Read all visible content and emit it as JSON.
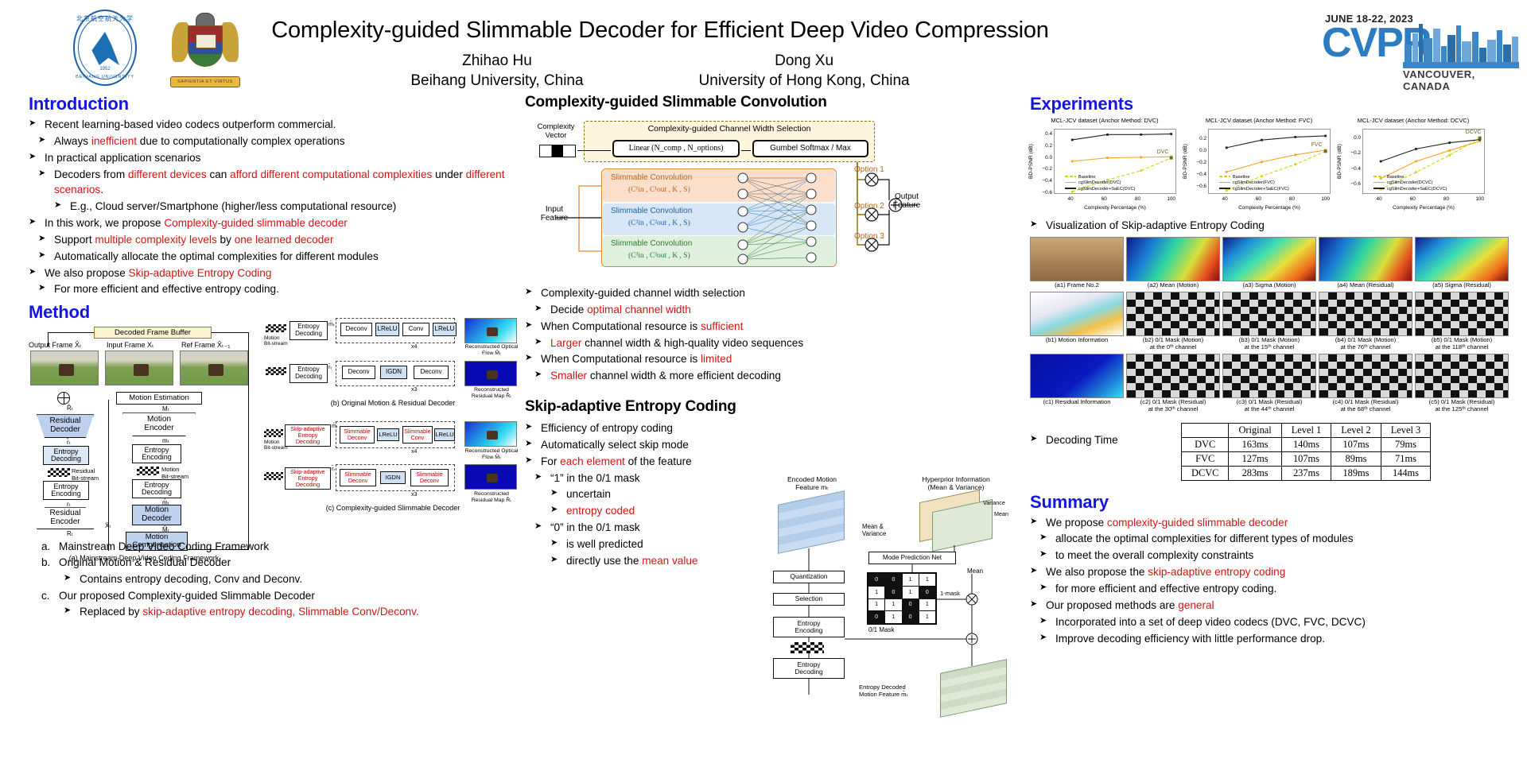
{
  "header": {
    "title": "Complexity-guided Slimmable Decoder for Efficient Deep Video Compression",
    "authors": [
      {
        "name": "Zhihao Hu",
        "affiliation": "Beihang University, China"
      },
      {
        "name": "Dong Xu",
        "affiliation": "University of Hong Kong, China"
      }
    ],
    "logo_buaa": {
      "cn": "北京航空航天大学",
      "year": "1952",
      "en": "BEIHANG UNIVERSITY"
    },
    "logo_hku": {
      "motto": "SAPIENTIA ET VIRTUS"
    },
    "cvpr": {
      "date": "JUNE 18-22, 2023",
      "word": "CVPR",
      "city": "VANCOUVER, CANADA"
    }
  },
  "introduction": {
    "heading": "Introduction",
    "items": [
      {
        "level": 0,
        "parts": [
          {
            "t": "Recent learning-based video codecs outperform commercial.",
            "c": "k"
          }
        ]
      },
      {
        "level": 1,
        "parts": [
          {
            "t": "Always ",
            "c": "k"
          },
          {
            "t": "inefficient",
            "c": "r"
          },
          {
            "t": " due to computationally complex operations",
            "c": "k"
          }
        ]
      },
      {
        "level": 0,
        "parts": [
          {
            "t": "In practical application scenarios",
            "c": "k"
          }
        ]
      },
      {
        "level": 1,
        "parts": [
          {
            "t": "Decoders from ",
            "c": "k"
          },
          {
            "t": "different devices",
            "c": "r"
          },
          {
            "t": " can ",
            "c": "k"
          },
          {
            "t": "afford different computational complexities",
            "c": "r"
          },
          {
            "t": " under ",
            "c": "k"
          },
          {
            "t": "different scenarios",
            "c": "r"
          },
          {
            "t": ".",
            "c": "k"
          }
        ]
      },
      {
        "level": 2,
        "parts": [
          {
            "t": "E.g., Cloud server/Smartphone (higher/less computational resource)",
            "c": "k"
          }
        ]
      },
      {
        "level": 0,
        "parts": [
          {
            "t": "In this work, we propose ",
            "c": "k"
          },
          {
            "t": "Complexity-guided slimmable decoder",
            "c": "r"
          }
        ]
      },
      {
        "level": 1,
        "parts": [
          {
            "t": "Support ",
            "c": "k"
          },
          {
            "t": "multiple complexity levels",
            "c": "r"
          },
          {
            "t": " by ",
            "c": "k"
          },
          {
            "t": "one learned decoder",
            "c": "r"
          }
        ]
      },
      {
        "level": 1,
        "parts": [
          {
            "t": "Automatically allocate the optimal complexities for different modules",
            "c": "k"
          }
        ]
      },
      {
        "level": 0,
        "parts": [
          {
            "t": "We also propose ",
            "c": "k"
          },
          {
            "t": "Skip-adaptive Entropy Coding",
            "c": "r"
          }
        ]
      },
      {
        "level": 1,
        "parts": [
          {
            "t": "For more efficient and effective entropy coding.",
            "c": "k"
          }
        ]
      }
    ]
  },
  "method": {
    "heading": "Method",
    "diagram_a": {
      "caption": "(a) Mainstream Deep Video Coding Framework",
      "decoded_frame_buffer": "Decoded Frame Buffer",
      "frames": [
        "Output Frame X̂ₜ",
        "Input Frame Xₜ",
        "Ref Frame X̂ₜ₋₁"
      ],
      "blocks": [
        "Residual\nDecoder",
        "Entropy\nDecoding",
        "Entropy\nEncoding",
        "Residual\nEncoder",
        "Motion Estimation",
        "Motion\nEncoder",
        "Entropy\nEncoding",
        "Entropy\nDecoding",
        "Motion\nDecoder",
        "Motion\nCompensation"
      ],
      "streams": [
        "Residual\nBit-stream",
        "Motion\nBit-stream"
      ],
      "signals": [
        "R̂ₜ",
        "r̂ₜ",
        "rₜ",
        "Rₜ",
        "Mₜ",
        "mₜ",
        "m̂ₜ",
        "M̂ₜ",
        "X̄ₜ"
      ]
    },
    "diagram_b": {
      "caption": "(b) Original Motion & Residual Decoder",
      "blocks": [
        "Entropy\nDecoding",
        "Deconv",
        "LReLU",
        "Conv",
        "LReLU",
        "Entropy\nDecoding",
        "Deconv",
        "IGDN",
        "Deconv"
      ],
      "repeats": [
        "x4",
        "x3"
      ],
      "outputs": [
        "Reconstructed\nOptical Flow M̂ₜ",
        "Reconstructed\nResidual Map R̂ₜ"
      ],
      "labels": [
        "m̂ₜ",
        "r̂ₜ",
        "Motion\nBit-stream"
      ]
    },
    "diagram_c": {
      "caption": "(c) Complexity-guided Slimmable Decoder",
      "blocks": [
        "Skip-adaptive\nEntropy\nDecoding",
        "Slimmable\nDeconv",
        "LReLU",
        "Slimmable\nConv",
        "LReLU",
        "Skip-adaptive\nEntropy\nDecoding",
        "Slimmable\nDeconv",
        "IGDN",
        "Slimmable\nDeconv"
      ],
      "repeats": [
        "x4",
        "x3"
      ],
      "outputs": [
        "Reconstructed\nOptical Flow M̂ₜ",
        "Reconstructed\nResidual Map R̂ₜ"
      ],
      "labels": [
        "m̂ₜ",
        "r̂ₜ",
        "Motion\nBit-stream"
      ]
    },
    "legend_items": [
      {
        "key": "a.",
        "text": "Mainstream Deep Video Coding Framework",
        "sub": []
      },
      {
        "key": "b.",
        "text": "Original Motion & Residual Decoder",
        "sub": [
          {
            "parts": [
              {
                "t": "Contains entropy decoding, Conv and Deconv.",
                "c": "k"
              }
            ]
          }
        ]
      },
      {
        "key": "c.",
        "text": "Our proposed Complexity-guided Slimmable Decoder",
        "sub": [
          {
            "parts": [
              {
                "t": "Replaced by ",
                "c": "k"
              },
              {
                "t": "skip-adaptive entropy decoding, Slimmable Conv/Deconv.",
                "c": "r"
              }
            ]
          }
        ]
      }
    ]
  },
  "slimconv": {
    "heading": "Complexity-guided Slimmable Convolution",
    "diagram": {
      "complexity_vector": "Complexity\nVector",
      "selector_title": "Complexity-guided Channel Width Selection",
      "linear": "Linear (N_comp , N_options)",
      "gumbel": "Gumbel Softmax / Max",
      "convs": [
        {
          "name": "Slimmable Convolution",
          "params": "(C¹in , C¹out , K , S)"
        },
        {
          "name": "Slimmable Convolution",
          "params": "(C²in , C²out , K , S)"
        },
        {
          "name": "Slimmable Convolution",
          "params": "(C³in , C³out , K , S)"
        }
      ],
      "options": [
        "Option 1",
        "Option 2",
        "Option 3"
      ],
      "input_label": "Input\nFeature",
      "output_label": "Output\nFeature"
    },
    "bullets": [
      {
        "level": 0,
        "parts": [
          {
            "t": "Complexity-guided channel width selection",
            "c": "k"
          }
        ]
      },
      {
        "level": 1,
        "parts": [
          {
            "t": "Decide ",
            "c": "k"
          },
          {
            "t": "optimal channel width",
            "c": "r"
          }
        ]
      },
      {
        "level": 0,
        "parts": [
          {
            "t": "When Computational resource is ",
            "c": "k"
          },
          {
            "t": "sufficient",
            "c": "r"
          }
        ]
      },
      {
        "level": 1,
        "parts": [
          {
            "t": "Larger",
            "c": "r"
          },
          {
            "t": " channel width & high-quality video sequences",
            "c": "k"
          }
        ]
      },
      {
        "level": 0,
        "parts": [
          {
            "t": "When Computational resource is ",
            "c": "k"
          },
          {
            "t": "limited",
            "c": "r"
          }
        ]
      },
      {
        "level": 1,
        "parts": [
          {
            "t": "Smaller",
            "c": "r"
          },
          {
            "t": " channel width & more efficient decoding",
            "c": "k"
          }
        ]
      }
    ]
  },
  "skipadaptive": {
    "heading": "Skip-adaptive Entropy Coding",
    "bullets": [
      {
        "level": 0,
        "parts": [
          {
            "t": "Efficiency of entropy coding",
            "c": "k"
          }
        ]
      },
      {
        "level": 0,
        "parts": [
          {
            "t": "Automatically select skip mode",
            "c": "k"
          }
        ]
      },
      {
        "level": 0,
        "parts": [
          {
            "t": "For ",
            "c": "k"
          },
          {
            "t": "each element",
            "c": "r"
          },
          {
            "t": " of the feature",
            "c": "k"
          }
        ]
      },
      {
        "level": 1,
        "parts": [
          {
            "t": "“1” in the 0/1 mask",
            "c": "k"
          }
        ]
      },
      {
        "level": 2,
        "parts": [
          {
            "t": "uncertain",
            "c": "k"
          }
        ]
      },
      {
        "level": 2,
        "parts": [
          {
            "t": "entropy coded",
            "c": "r"
          }
        ]
      },
      {
        "level": 1,
        "parts": [
          {
            "t": "“0” in the 0/1 mask",
            "c": "k"
          }
        ]
      },
      {
        "level": 2,
        "parts": [
          {
            "t": "is well predicted",
            "c": "k"
          }
        ]
      },
      {
        "level": 2,
        "parts": [
          {
            "t": "directly use the ",
            "c": "k"
          },
          {
            "t": "mean value",
            "c": "r"
          }
        ]
      }
    ],
    "diagram": {
      "encoded_title": "Encoded Motion\nFeature mₜ",
      "hyper_title": "Hyperprior Information\n(Mean & Variance)",
      "variance": "Variance",
      "mean": "Mean",
      "mean_variance": "Mean &\nVariance",
      "mode_net": "Mode Prediction Net",
      "quantization": "Quantization",
      "selection": "Selection",
      "entropy_encoding": "Entropy\nEncoding",
      "entropy_decoding": "Entropy\nDecoding",
      "mask_label": "0/1 Mask",
      "one_minus_mask": "1-mask",
      "mean_label": "Mean",
      "decoded_label": "Entropy Decoded\nMotion Feature m̂ₜ",
      "mask_bits": [
        [
          "0",
          "0",
          "1",
          "1"
        ],
        [
          "1",
          "0",
          "1",
          "0"
        ],
        [
          "1",
          "1",
          "0",
          "1"
        ],
        [
          "0",
          "1",
          "0",
          "1"
        ]
      ]
    }
  },
  "experiments": {
    "heading": "Experiments",
    "viz_heading": "Visualization of Skip-adaptive Entropy Coding",
    "decoding_time_heading": "Decoding Time",
    "viz_cells": [
      {
        "cap": "(a1) Frame No.2",
        "kind": "photo"
      },
      {
        "cap": "(a2) Mean (Motion)",
        "kind": "jet"
      },
      {
        "cap": "(a3) Sigma (Motion)",
        "kind": "jet2"
      },
      {
        "cap": "(a4) Mean (Residual)",
        "kind": "jet"
      },
      {
        "cap": "(a5) Sigma (Residual)",
        "kind": "jet2"
      },
      {
        "cap": "(b1) Motion Information",
        "kind": "motion"
      },
      {
        "cap": "(b2) 0/1 Mask (Motion)\nat the 0ᵗʰ channel",
        "kind": "mask"
      },
      {
        "cap": "(b3) 0/1 Mask (Motion)\nat the 15ᵗʰ channel",
        "kind": "mask"
      },
      {
        "cap": "(b4) 0/1 Mask (Motion)\nat the 76ᵗʰ channel",
        "kind": "mask"
      },
      {
        "cap": "(b5) 0/1 Mask (Motion)\nat the 118ᵗʰ channel",
        "kind": "mask"
      },
      {
        "cap": "(c1) Residual Information",
        "kind": "residual"
      },
      {
        "cap": "(c2) 0/1 Mask (Residual)\nat the 30ᵗʰ channel",
        "kind": "mask"
      },
      {
        "cap": "(c3) 0/1 Mask (Residual)\nat the 44ᵗʰ channel",
        "kind": "mask"
      },
      {
        "cap": "(c4) 0/1 Mask (Residual)\nat the 68ᵗʰ channel",
        "kind": "mask"
      },
      {
        "cap": "(c5) 0/1 Mask (Residual)\nat the 125ᵗʰ channel",
        "kind": "mask"
      }
    ],
    "decoding_time_table": {
      "columns": [
        "",
        "Original",
        "Level 1",
        "Level 2",
        "Level 3"
      ],
      "rows": [
        {
          "method": "DVC",
          "values": [
            "163ms",
            "140ms",
            "107ms",
            "79ms"
          ]
        },
        {
          "method": "FVC",
          "values": [
            "127ms",
            "107ms",
            "89ms",
            "71ms"
          ]
        },
        {
          "method": "DCVC",
          "values": [
            "283ms",
            "237ms",
            "189ms",
            "144ms"
          ]
        }
      ]
    }
  },
  "chart_data": [
    {
      "type": "line",
      "title": "MCL-JCV dataset (Anchor Method: DVC)",
      "xlabel": "Complexity Percentage (%)",
      "ylabel": "BD-PSNR (dB)",
      "xlim": [
        30,
        103
      ],
      "ylim": [
        -0.62,
        0.5
      ],
      "xticks": [
        40,
        60,
        80,
        100
      ],
      "yticks": [
        0.4,
        0.2,
        0.0,
        -0.2,
        -0.4,
        -0.6
      ],
      "anchor_label": "DVC",
      "legend_position": "bottom-center",
      "series": [
        {
          "name": "Baseline",
          "color": "#d4d400",
          "style": "dashed",
          "x": [
            41,
            62,
            82,
            100
          ],
          "y": [
            -0.58,
            -0.38,
            -0.22,
            0.0
          ]
        },
        {
          "name": "cgSlimDecoder(DVC)",
          "color": "#f5a623",
          "style": "solid",
          "x": [
            41,
            62,
            82,
            100
          ],
          "y": [
            -0.06,
            0.0,
            0.01,
            0.02
          ]
        },
        {
          "name": "cgSlimDecoder+SaEC(DVC)",
          "color": "#222222",
          "style": "solid",
          "x": [
            41,
            62,
            82,
            100
          ],
          "y": [
            0.31,
            0.4,
            0.4,
            0.41
          ]
        }
      ]
    },
    {
      "type": "line",
      "title": "MCL-JCV dataset (Anchor Method: FVC)",
      "xlabel": "Complexity Percentage (%)",
      "ylabel": "BD-PSNR (dB)",
      "xlim": [
        30,
        103
      ],
      "ylim": [
        -0.72,
        0.38
      ],
      "xticks": [
        40,
        60,
        80,
        100
      ],
      "yticks": [
        0.2,
        0.0,
        -0.2,
        -0.4,
        -0.6
      ],
      "anchor_label": "FVC",
      "legend_position": "bottom-center",
      "series": [
        {
          "name": "Baseline",
          "color": "#d4d400",
          "style": "dashed",
          "x": [
            41,
            62,
            82,
            100
          ],
          "y": [
            -0.66,
            -0.42,
            -0.22,
            0.0
          ]
        },
        {
          "name": "cgSlimDecoder(FVC)",
          "color": "#f5a623",
          "style": "solid",
          "x": [
            41,
            62,
            82,
            100
          ],
          "y": [
            -0.35,
            -0.18,
            -0.06,
            0.02
          ]
        },
        {
          "name": "cgSlimDecoder+SaEC(FVC)",
          "color": "#222222",
          "style": "solid",
          "x": [
            41,
            62,
            82,
            100
          ],
          "y": [
            0.06,
            0.19,
            0.24,
            0.26
          ]
        }
      ]
    },
    {
      "type": "line",
      "title": "MCL-JCV dataset (Anchor Method: DCVC)",
      "xlabel": "Complexity Percentage (%)",
      "ylabel": "BD-PSNR (dB)",
      "xlim": [
        30,
        103
      ],
      "ylim": [
        -0.72,
        0.12
      ],
      "xticks": [
        40,
        60,
        80,
        100
      ],
      "yticks": [
        0.0,
        -0.2,
        -0.4,
        -0.6
      ],
      "anchor_label": "DCVC",
      "legend_position": "bottom-center",
      "series": [
        {
          "name": "Baseline",
          "color": "#d4d400",
          "style": "dashed",
          "x": [
            41,
            62,
            82,
            100
          ],
          "y": [
            -0.66,
            -0.44,
            -0.22,
            0.0
          ]
        },
        {
          "name": "cgSlimDecoder(DCVC)",
          "color": "#f5a623",
          "style": "solid",
          "x": [
            41,
            62,
            82,
            100
          ],
          "y": [
            -0.52,
            -0.3,
            -0.16,
            -0.04
          ]
        },
        {
          "name": "cgSlimDecoder+SaEC(DCVC)",
          "color": "#222222",
          "style": "solid",
          "x": [
            41,
            62,
            82,
            100
          ],
          "y": [
            -0.3,
            -0.14,
            -0.06,
            -0.02
          ]
        }
      ]
    }
  ],
  "summary": {
    "heading": "Summary",
    "items": [
      {
        "level": 0,
        "parts": [
          {
            "t": "We propose ",
            "c": "k"
          },
          {
            "t": "complexity-guided slimmable decoder",
            "c": "r"
          }
        ]
      },
      {
        "level": 1,
        "parts": [
          {
            "t": "allocate the optimal complexities for different types of modules",
            "c": "k"
          }
        ]
      },
      {
        "level": 1,
        "parts": [
          {
            "t": "to meet the overall complexity constraints",
            "c": "k"
          }
        ]
      },
      {
        "level": 0,
        "parts": [
          {
            "t": "We also propose the ",
            "c": "k"
          },
          {
            "t": "skip-adaptive entropy coding",
            "c": "r"
          }
        ]
      },
      {
        "level": 1,
        "parts": [
          {
            "t": "for more efficient and effective entropy coding.",
            "c": "k"
          }
        ]
      },
      {
        "level": 0,
        "parts": [
          {
            "t": "Our proposed methods are ",
            "c": "k"
          },
          {
            "t": "general",
            "c": "r"
          }
        ]
      },
      {
        "level": 1,
        "parts": [
          {
            "t": "Incorporated into a set of deep video codecs (DVC, FVC, DCVC)",
            "c": "k"
          }
        ]
      },
      {
        "level": 1,
        "parts": [
          {
            "t": "Improve decoding efficiency with little performance drop.",
            "c": "k"
          }
        ]
      }
    ]
  },
  "colors": {
    "heading_blue": "#1515e0",
    "accent_red": "#d81212",
    "cvpr_blue": "#2b7cc0",
    "series_black": "#222222",
    "series_orange": "#f5a623",
    "series_yellow": "#d4d400"
  }
}
